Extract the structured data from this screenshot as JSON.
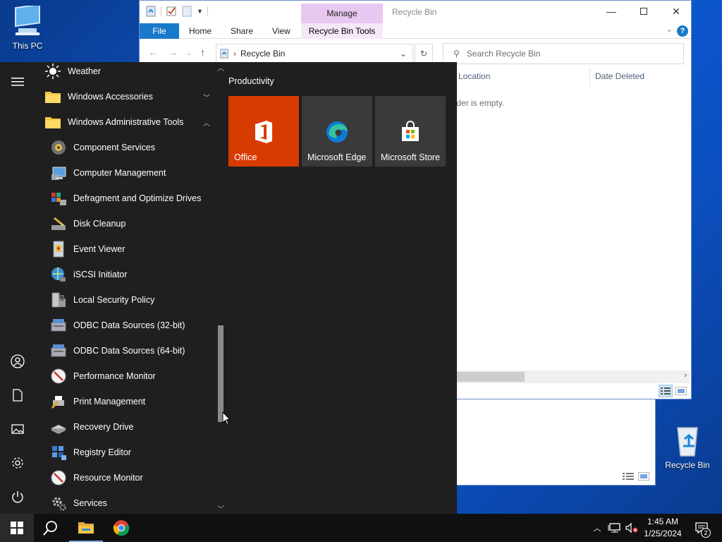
{
  "desktop": {
    "this_pc_label": "This PC",
    "recycle_bin_label": "Recycle Bin"
  },
  "explorer": {
    "manage_tab": "Manage",
    "title": "Recycle Bin",
    "tabs": {
      "file": "File",
      "home": "Home",
      "share": "Share",
      "view": "View",
      "recycle_bin_tools": "Recycle Bin Tools"
    },
    "address": "Recycle Bin",
    "search_placeholder": "Search Recycle Bin",
    "columns": {
      "location": "Location",
      "date_deleted": "Date Deleted"
    },
    "empty_message": "older is empty.",
    "help_label": "?"
  },
  "start_menu": {
    "apps": [
      {
        "label": "Weather",
        "icon": "weather-icon"
      },
      {
        "label": "Windows Accessories",
        "icon": "folder-icon"
      },
      {
        "label": "Windows Administrative Tools",
        "icon": "folder-icon"
      },
      {
        "label": "Component Services",
        "icon": "component-services-icon"
      },
      {
        "label": "Computer Management",
        "icon": "computer-management-icon"
      },
      {
        "label": "Defragment and Optimize Drives",
        "icon": "defragment-icon"
      },
      {
        "label": "Disk Cleanup",
        "icon": "disk-cleanup-icon"
      },
      {
        "label": "Event Viewer",
        "icon": "event-viewer-icon"
      },
      {
        "label": "iSCSI Initiator",
        "icon": "iscsi-icon"
      },
      {
        "label": "Local Security Policy",
        "icon": "security-policy-icon"
      },
      {
        "label": "ODBC Data Sources (32-bit)",
        "icon": "odbc-icon"
      },
      {
        "label": "ODBC Data Sources (64-bit)",
        "icon": "odbc-icon"
      },
      {
        "label": "Performance Monitor",
        "icon": "performance-monitor-icon"
      },
      {
        "label": "Print Management",
        "icon": "print-management-icon"
      },
      {
        "label": "Recovery Drive",
        "icon": "recovery-drive-icon"
      },
      {
        "label": "Registry Editor",
        "icon": "registry-editor-icon"
      },
      {
        "label": "Resource Monitor",
        "icon": "resource-monitor-icon"
      },
      {
        "label": "Services",
        "icon": "services-icon"
      }
    ],
    "group_title": "Productivity",
    "tiles": [
      {
        "label": "Office",
        "color": "#d83b01"
      },
      {
        "label": "Microsoft Edge",
        "color": "#3a3a3a"
      },
      {
        "label": "Microsoft Store",
        "color": "#3a3a3a"
      }
    ]
  },
  "taskbar": {
    "time": "1:45 AM",
    "date": "1/25/2024",
    "notification_count": "2"
  }
}
